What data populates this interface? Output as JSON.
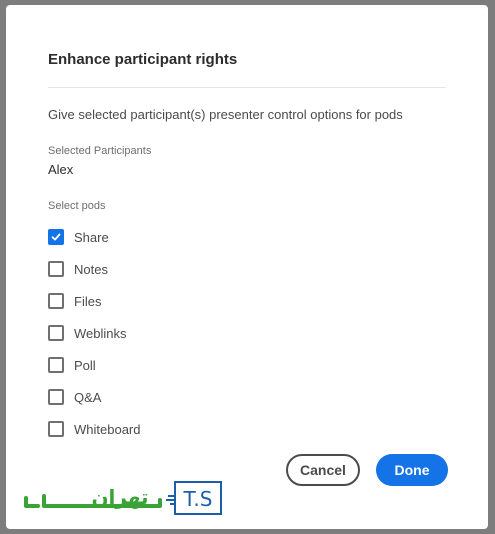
{
  "dialog": {
    "title": "Enhance participant rights",
    "description": "Give selected participant(s) presenter control options for pods",
    "selected_participants_label": "Selected Participants",
    "selected_participant": "Alex",
    "select_pods_label": "Select pods",
    "pods": [
      {
        "label": "Share",
        "checked": true
      },
      {
        "label": "Notes",
        "checked": false
      },
      {
        "label": "Files",
        "checked": false
      },
      {
        "label": "Weblinks",
        "checked": false
      },
      {
        "label": "Poll",
        "checked": false
      },
      {
        "label": "Q&A",
        "checked": false
      },
      {
        "label": "Whiteboard",
        "checked": false
      }
    ],
    "cancel_label": "Cancel",
    "done_label": "Done"
  },
  "watermark": {
    "logo_text": "T.S",
    "brand_text": "تهران"
  },
  "colors": {
    "accent": "#1473e6",
    "watermark_blue": "#1a5fa8",
    "watermark_green": "#3aa335"
  }
}
